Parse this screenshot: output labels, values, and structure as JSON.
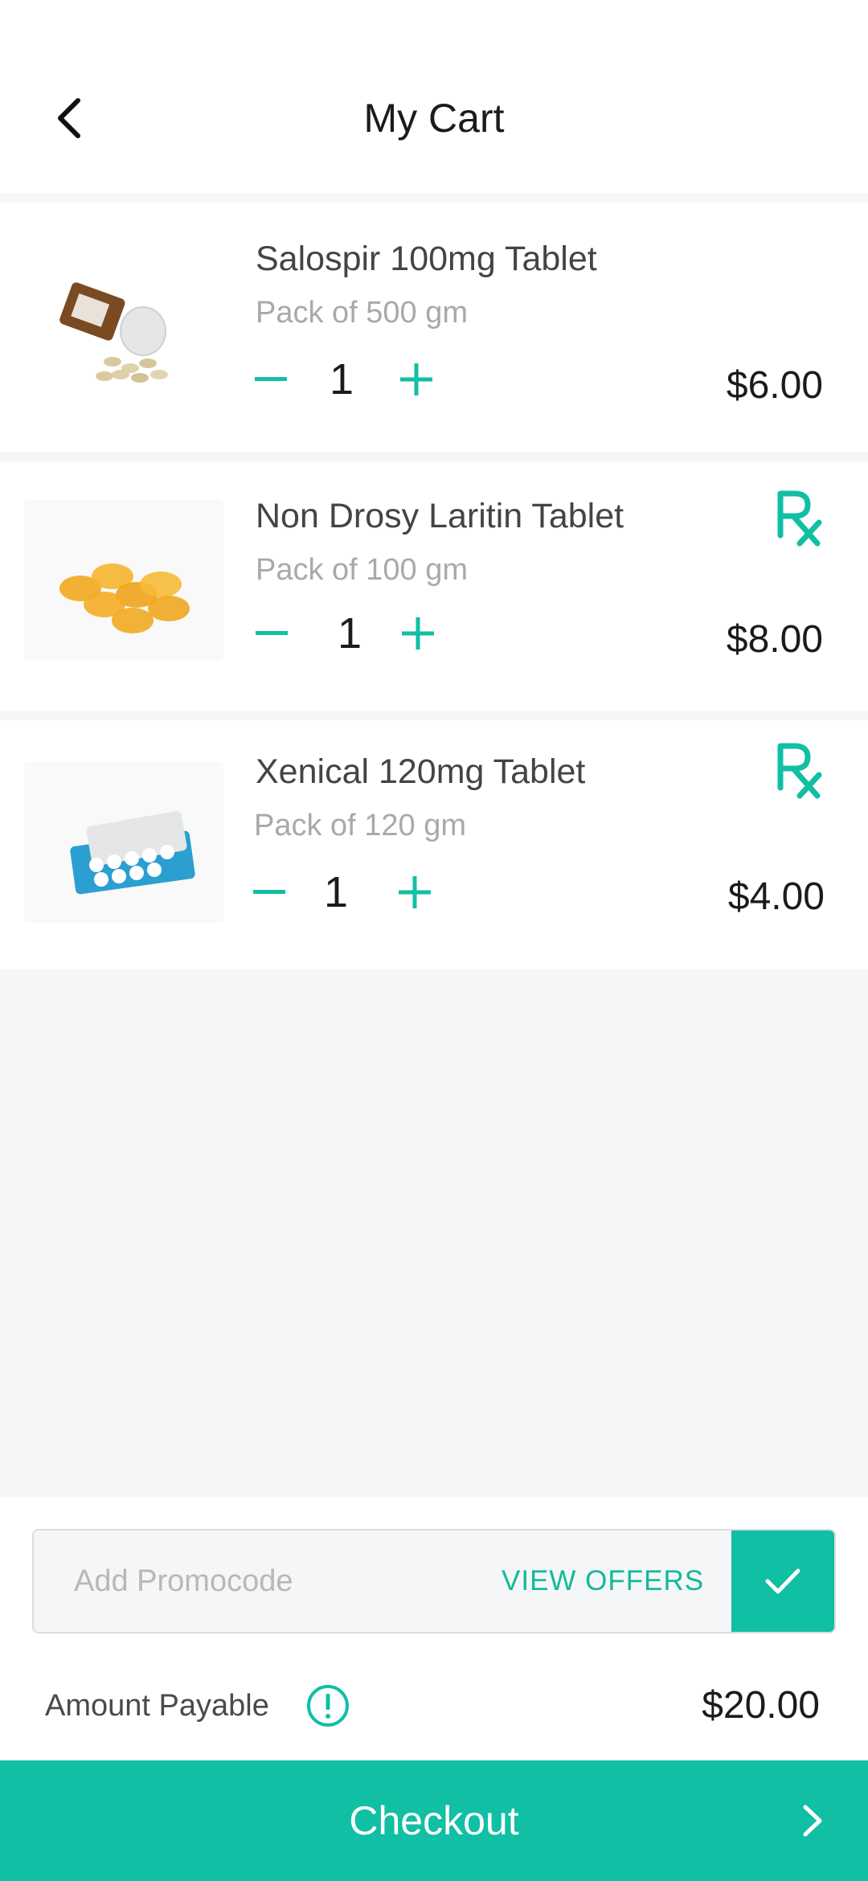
{
  "header": {
    "title": "My Cart"
  },
  "items": [
    {
      "name": "Salospir 100mg Tablet",
      "pack": "Pack of 500 gm",
      "qty": "1",
      "price": "$6.00",
      "rx": false
    },
    {
      "name": "Non Drosy Laritin Tablet",
      "pack": "Pack of 100 gm",
      "qty": "1",
      "price": "$8.00",
      "rx": true
    },
    {
      "name": "Xenical 120mg Tablet",
      "pack": "Pack of 120 gm",
      "qty": "1",
      "price": "$4.00",
      "rx": true
    }
  ],
  "promo": {
    "placeholder": "Add Promocode",
    "view_offers": "VIEW OFFERS"
  },
  "summary": {
    "amount_label": "Amount Payable",
    "amount_value": "$20.00"
  },
  "checkout": {
    "label": "Checkout"
  },
  "colors": {
    "accent": "#11bfa4",
    "text": "#1b1b1b",
    "muted": "#a9a9a9"
  }
}
